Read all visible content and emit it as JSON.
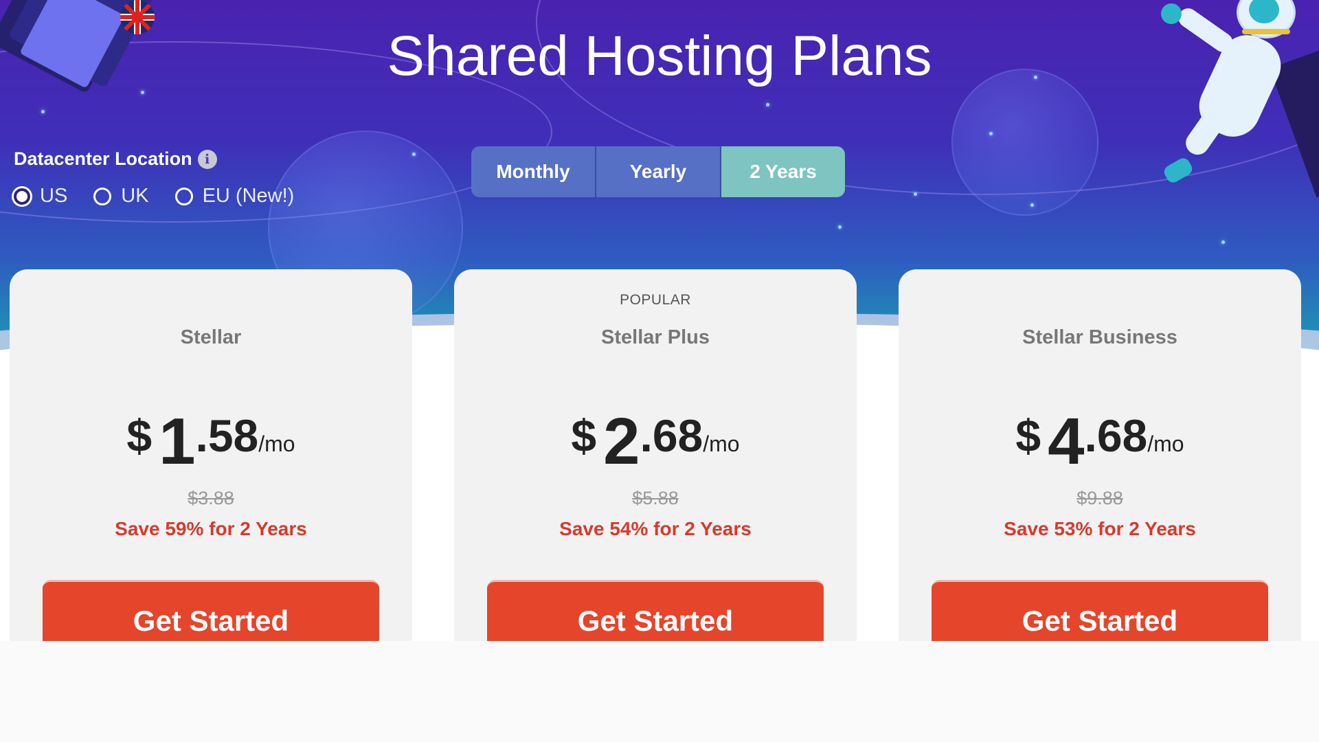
{
  "header": {
    "title": "Shared Hosting Plans"
  },
  "datacenter": {
    "label": "Datacenter Location",
    "info_icon": "info-icon",
    "options": [
      {
        "label": "US",
        "checked": true
      },
      {
        "label": "UK",
        "checked": false
      },
      {
        "label": "EU (New!)",
        "checked": false
      }
    ]
  },
  "billing_toggle": {
    "options": [
      {
        "label": "Monthly",
        "active": false
      },
      {
        "label": "Yearly",
        "active": false
      },
      {
        "label": "2 Years",
        "active": true
      }
    ],
    "active_color": "#7ec4c0",
    "inactive_color": "#5670c6"
  },
  "plans": [
    {
      "badge": "",
      "name": "Stellar",
      "currency": "$",
      "price_int": "1",
      "price_dec": ".58",
      "unit": "/mo",
      "old_price": "$3.88",
      "save": "Save 59% for 2 Years",
      "cta": "Get Started"
    },
    {
      "badge": "POPULAR",
      "name": "Stellar Plus",
      "currency": "$",
      "price_int": "2",
      "price_dec": ".68",
      "unit": "/mo",
      "old_price": "$5.88",
      "save": "Save 54% for 2 Years",
      "cta": "Get Started"
    },
    {
      "badge": "",
      "name": "Stellar Business",
      "currency": "$",
      "price_int": "4",
      "price_dec": ".68",
      "unit": "/mo",
      "old_price": "$9.88",
      "save": "Save 53% for 2 Years",
      "cta": "Get Started"
    }
  ],
  "colors": {
    "cta": "#e5452b",
    "save_text": "#d9392b",
    "hero_top": "#4a22b0",
    "hero_bottom": "#14a6a6"
  },
  "decor": {
    "server_illustration": "server-icon",
    "uk_flag": "uk-flag-icon",
    "mascot": "yeti-astronaut-icon"
  }
}
